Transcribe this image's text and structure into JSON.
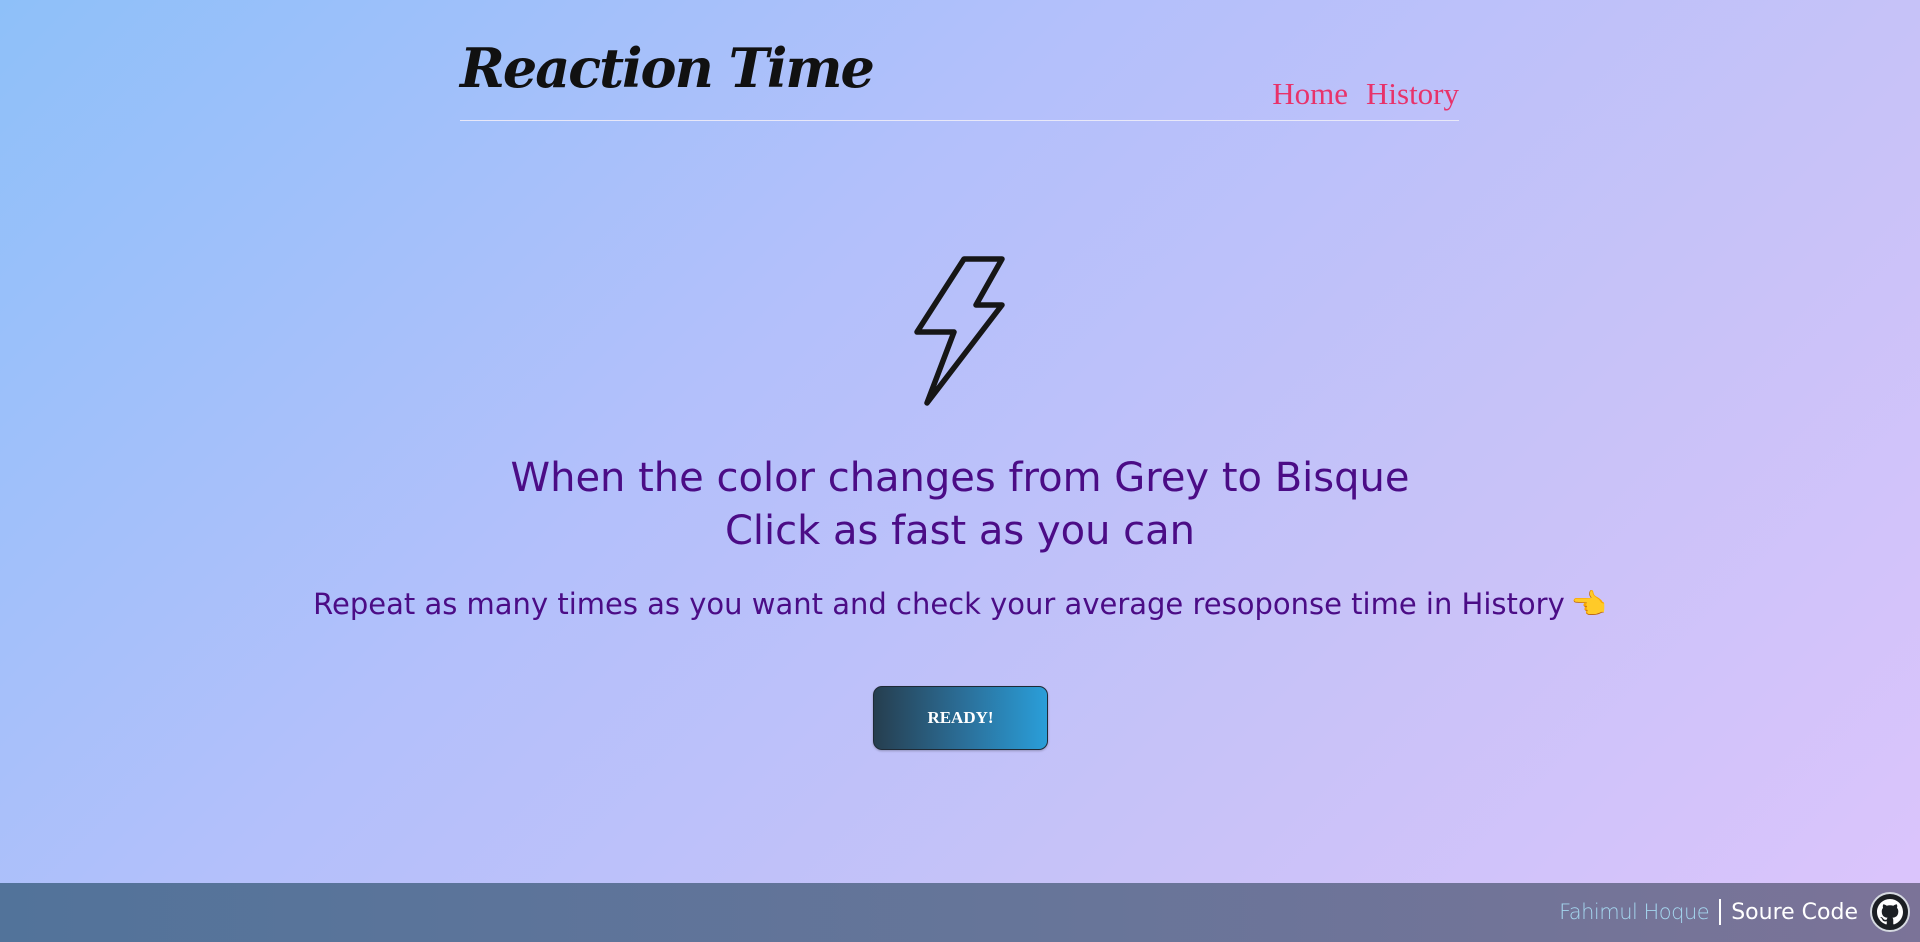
{
  "header": {
    "title": "Reaction Time",
    "nav": {
      "home": "Home",
      "history": "History"
    }
  },
  "main": {
    "heading_line1": "When the color changes from Grey to Bisque",
    "heading_line2": "Click as fast as you can",
    "subheading": "Repeat as many times as you want and check your average resoponse time in History",
    "pointer_emoji": "👈",
    "ready_button": "READY!"
  },
  "footer": {
    "author": "Fahimul Hoque",
    "source_label": "Soure Code"
  },
  "icons": {
    "bolt": "lightning-bolt-icon",
    "github": "github-icon"
  },
  "colors": {
    "nav_link": "#e8326a",
    "heading": "#4b0c86"
  }
}
